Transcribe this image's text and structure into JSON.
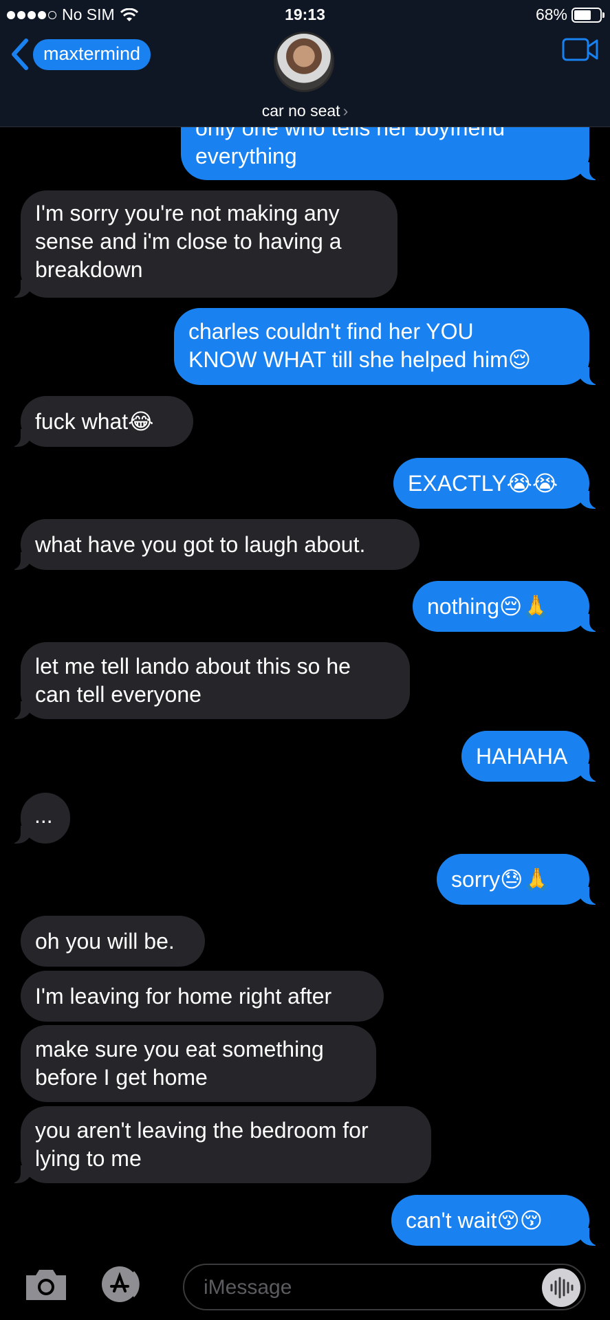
{
  "status_bar": {
    "carrier": "No SIM",
    "time": "19:13",
    "battery": "68%",
    "battery_level": 0.68
  },
  "header": {
    "contact_name": "maxtermind",
    "contact_subtitle": "car no seat",
    "chevron": "›",
    "icons": [
      "back-chevron-icon",
      "avatar",
      "video-camera-icon"
    ]
  },
  "colors": {
    "outgoing_bubble": "#1a82f0",
    "incoming_bubble": "#26252a",
    "header_bg": "#0f1624",
    "background": "#000000"
  },
  "messages": [
    {
      "dir": "out",
      "text": "only one who tells her boyfriend\neverything"
    },
    {
      "dir": "in",
      "text": "I'm sorry you're not making any\nsense and i'm close to having a\nbreakdown"
    },
    {
      "dir": "out",
      "text": "charles couldn't find her YOU\nKNOW WHAT till she helped him😌"
    },
    {
      "dir": "in",
      "text": "fuck what😂"
    },
    {
      "dir": "out",
      "text": "EXACTLY😭😭"
    },
    {
      "dir": "in",
      "text": "what have you got to laugh about."
    },
    {
      "dir": "out",
      "text": "nothing😔🙏"
    },
    {
      "dir": "in",
      "text": "let me tell lando about this so he\ncan tell everyone"
    },
    {
      "dir": "out",
      "text": "HAHAHA"
    },
    {
      "dir": "in",
      "text": "..."
    },
    {
      "dir": "out",
      "text": "sorry😓🙏"
    },
    {
      "dir": "in",
      "text": "oh you will be."
    },
    {
      "dir": "in",
      "text": "I'm leaving for home right after"
    },
    {
      "dir": "in",
      "text": "make sure you eat something\nbefore I get home"
    },
    {
      "dir": "in",
      "text": "you aren't leaving the bedroom for\nlying to me"
    },
    {
      "dir": "out",
      "text": "can't wait😚😚"
    }
  ],
  "input_bar": {
    "placeholder": "iMessage",
    "icons": [
      "camera-icon",
      "app-store-icon",
      "audio-waveform-icon"
    ]
  }
}
